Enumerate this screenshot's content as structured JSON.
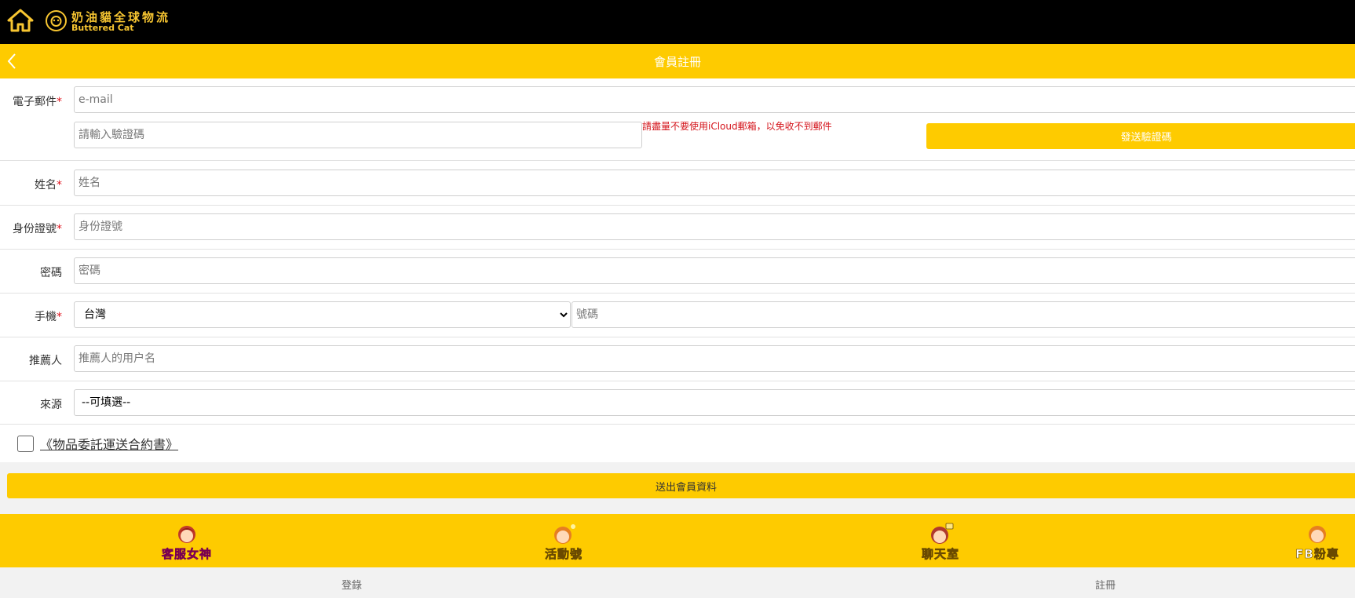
{
  "header": {
    "brand_cn": "奶油貓全球物流",
    "brand_en": "Buttered Cat",
    "page_title": "會員註冊"
  },
  "form": {
    "required_mark": "*",
    "email": {
      "label": "電子郵件",
      "placeholder": "e-mail"
    },
    "verify_code": {
      "placeholder": "請輸入驗證碼",
      "note": "請盡量不要使用iCloud郵箱，以免收不到郵件",
      "send_button": "發送驗證碼"
    },
    "name": {
      "label": "姓名",
      "placeholder": "姓名"
    },
    "id_number": {
      "label": "身份證號",
      "placeholder": "身份證號"
    },
    "password": {
      "label": "密碼",
      "placeholder": "密碼"
    },
    "mobile": {
      "label": "手機",
      "country_selected": "台灣",
      "placeholder": "號碼"
    },
    "referrer": {
      "label": "推薦人",
      "placeholder": "推薦人的用户名"
    },
    "source": {
      "label": "來源",
      "selected": "--可填選--"
    },
    "agreement_link": "《物品委託運送合約書》",
    "submit_button": "送出會員資料"
  },
  "bottom_nav": [
    {
      "label": "客服女神",
      "icon": "support-girl-avatar-icon"
    },
    {
      "label": "活動號",
      "icon": "event-girl-avatar-icon"
    },
    {
      "label": "聊天室",
      "icon": "chat-girl-avatar-icon"
    },
    {
      "label": "FB粉專",
      "icon": "fb-girl-avatar-icon"
    }
  ],
  "footer": {
    "login": "登錄",
    "register": "註冊"
  },
  "colors": {
    "brand_yellow": "#fecb00",
    "top_bar": "#000000",
    "required_red": "#e0141e"
  }
}
